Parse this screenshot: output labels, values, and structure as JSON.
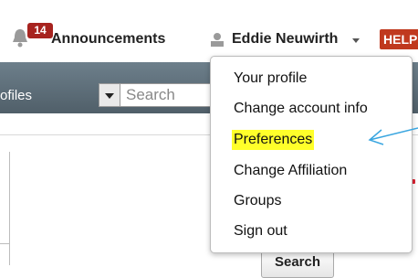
{
  "header": {
    "notification_count": "14",
    "announcements_label": "Announcements",
    "user_name": "Eddie Neuwirth",
    "help_label": "HELP"
  },
  "navbar": {
    "category_partial_label": "ofiles",
    "search_placeholder": "Search"
  },
  "content": {
    "search_button_label": "Search"
  },
  "dropdown": {
    "items": [
      {
        "label": "Your profile"
      },
      {
        "label": "Change account info"
      },
      {
        "label": "Preferences"
      },
      {
        "label": "Change Affiliation"
      },
      {
        "label": "Groups"
      },
      {
        "label": "Sign out"
      }
    ],
    "highlighted_item": "Preferences",
    "highlight_color": "#ffff2a"
  },
  "annotation": {
    "arrow_color": "#3aa6e0"
  }
}
